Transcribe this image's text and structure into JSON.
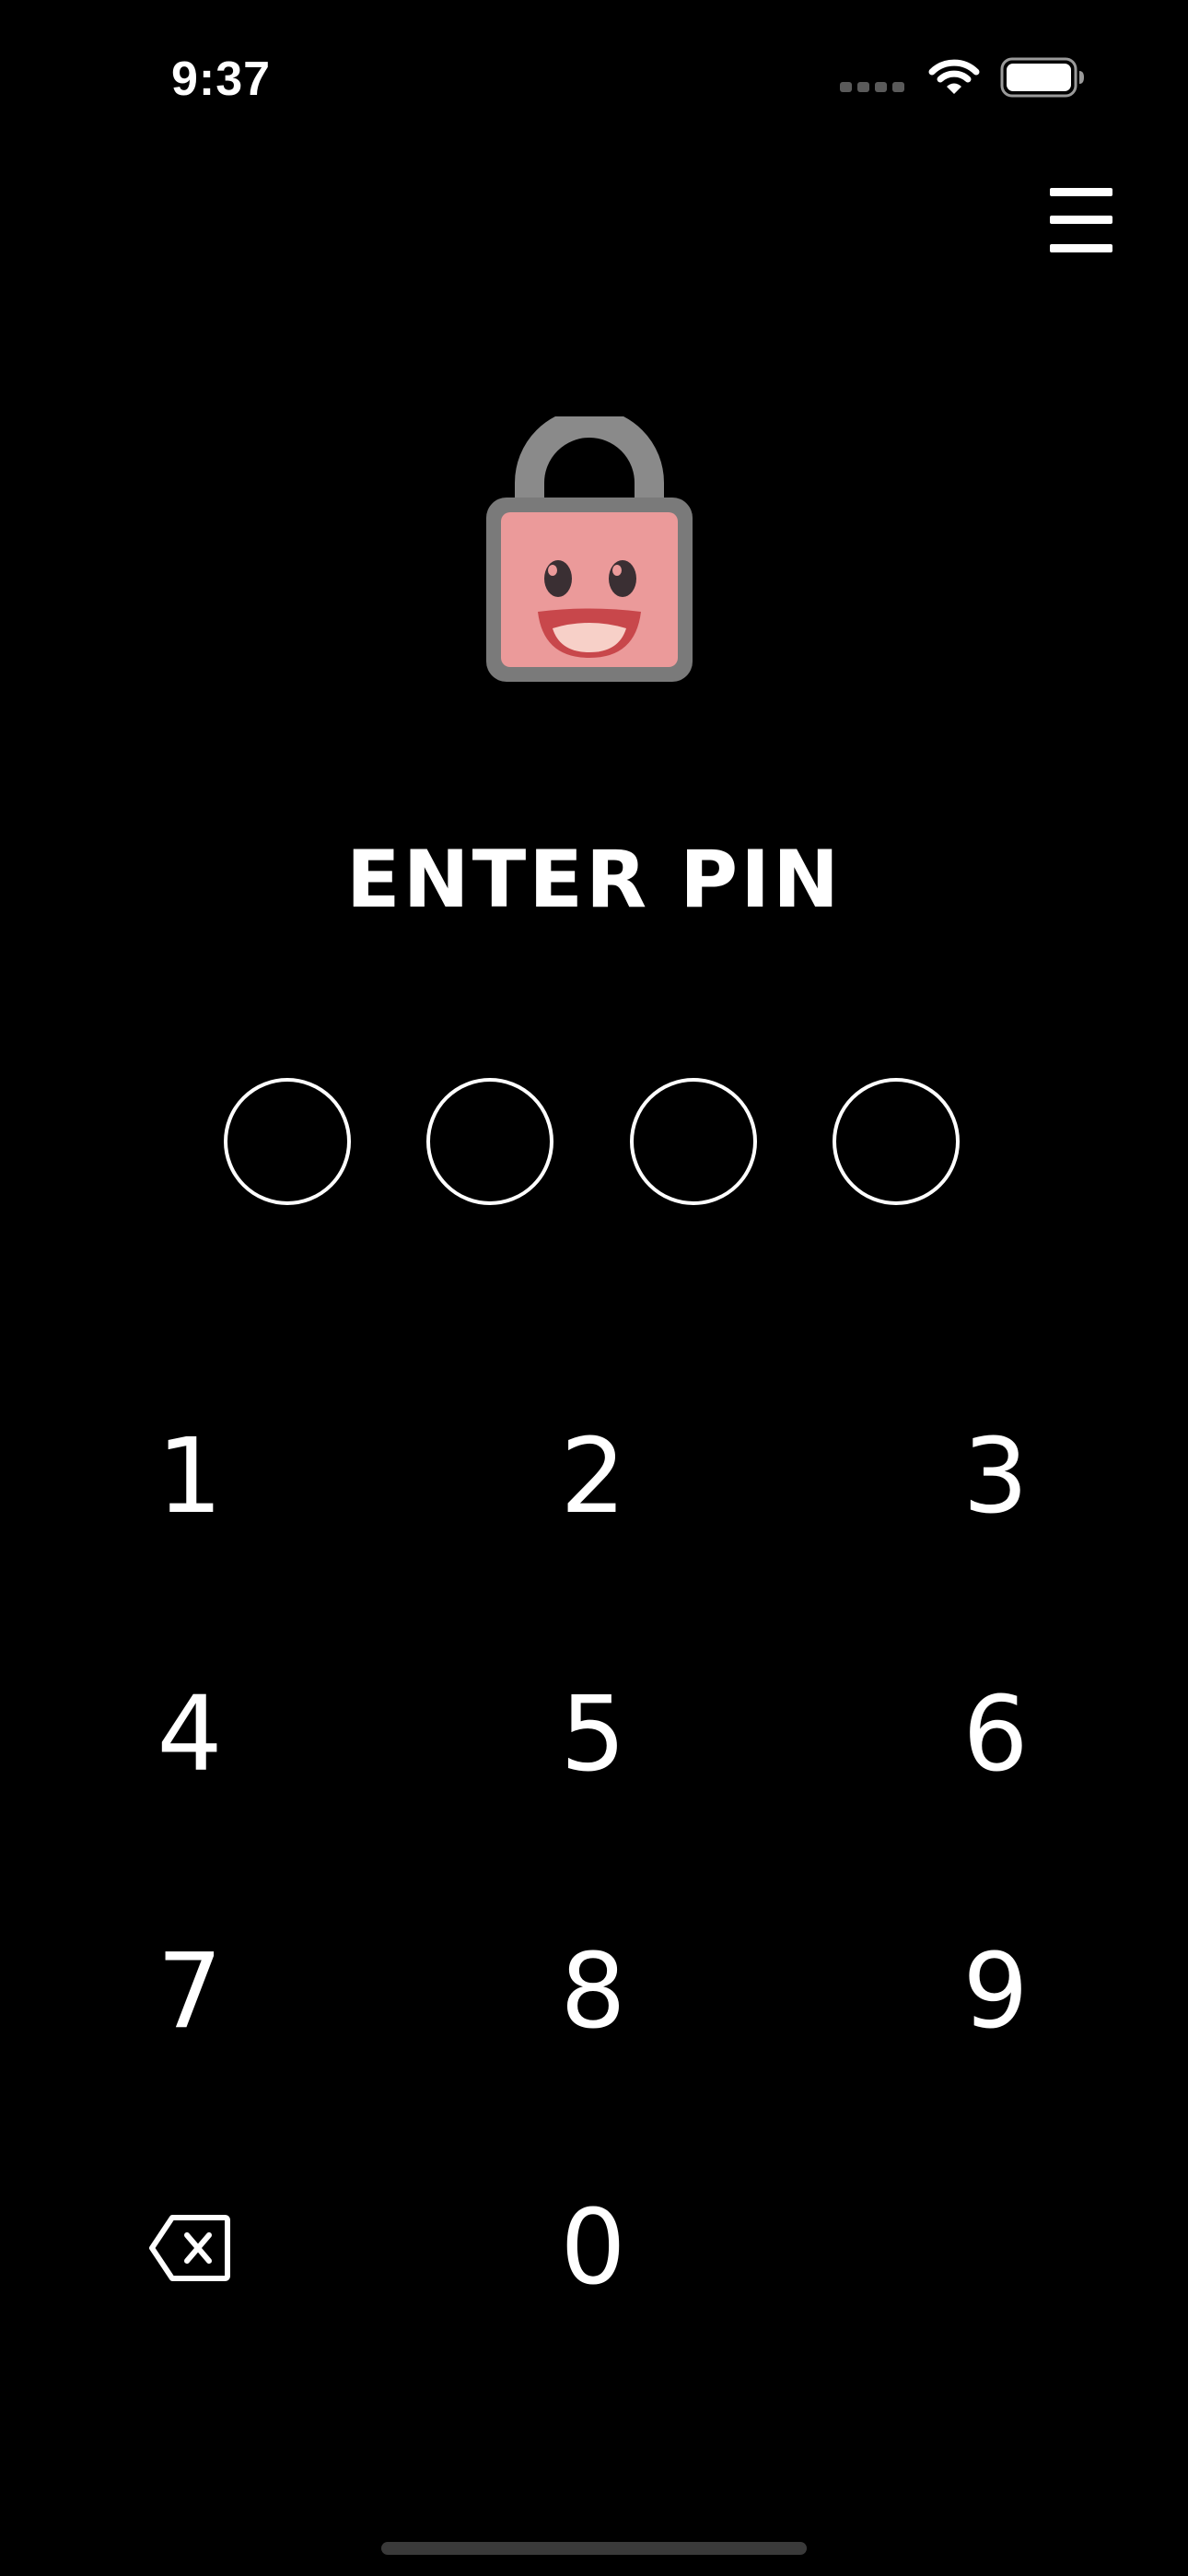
{
  "status_bar": {
    "time": "9:37"
  },
  "header": {
    "menu_icon": "hamburger-menu-icon"
  },
  "lock": {
    "icon": "smiling-padlock-icon",
    "colors": {
      "shackle": "#8a8a8a",
      "body_border": "#777777",
      "face": "#eb9a9a",
      "mouth": "#c8474b",
      "teeth": "#f7d0c8",
      "eyes": "#3a2f33"
    }
  },
  "prompt": {
    "title": "ENTER PIN"
  },
  "pin": {
    "length": 4,
    "entered": 0
  },
  "keypad": {
    "keys": [
      "1",
      "2",
      "3",
      "4",
      "5",
      "6",
      "7",
      "8",
      "9",
      "0"
    ],
    "backspace_icon": "backspace-icon"
  }
}
